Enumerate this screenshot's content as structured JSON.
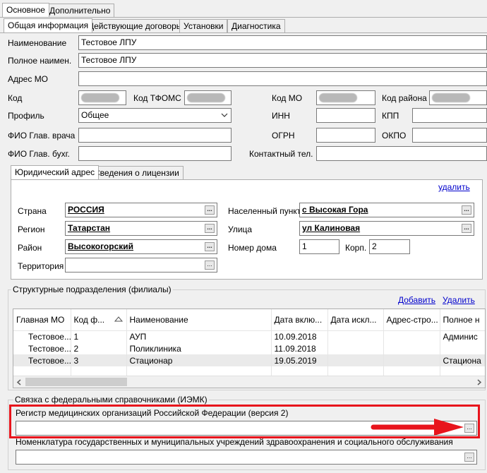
{
  "top_tabs": [
    "Основное",
    "Дополнительно"
  ],
  "sub_tabs": [
    "Общая информация",
    "Действующие договоры",
    "Установки",
    "Диагностика"
  ],
  "general": {
    "name_label": "Наименование",
    "name_value": "Тестовое ЛПУ",
    "fullname_label": "Полное наимен.",
    "fullname_value": "Тестовое ЛПУ",
    "address_label": "Адрес МО",
    "address_value": "",
    "code_label": "Код",
    "tfoms_label": "Код ТФОМС",
    "mo_code_label": "Код МО",
    "district_code_label": "Код района",
    "profile_label": "Профиль",
    "profile_value": "Общее",
    "inn_label": "ИНН",
    "kpp_label": "КПП",
    "head_label": "ФИО Глав. врача",
    "ogrn_label": "ОГРН",
    "okpo_label": "ОКПО",
    "accountant_label": "ФИО Глав. бухг.",
    "phone_label": "Контактный тел."
  },
  "address_tabs": [
    "Юридический адрес",
    "Сведения о лицензии"
  ],
  "address": {
    "delete_link": "удалить",
    "country_label": "Страна",
    "country_value": "РОССИЯ",
    "region_label": "Регион",
    "region_value": "Татарстан",
    "district_label": "Район",
    "district_value": "Высокогорский",
    "territory_label": "Территория",
    "territory_value": "",
    "settlement_label": "Населенный пункт",
    "settlement_value": "с Высокая Гора",
    "street_label": "Улица",
    "street_value": "ул Калиновая",
    "house_label": "Номер дома",
    "house_value": "1",
    "building_label": "Корп.",
    "building_value": "2",
    "dots": "..."
  },
  "branches": {
    "title": "Структурные подразделения (филиалы)",
    "add_link": "Добавить",
    "delete_link": "Удалить",
    "columns": [
      "Главная МО",
      "Код ф...",
      "Наименование",
      "Дата вклю...",
      "Дата искл...",
      "Адрес-стро...",
      "Полное н"
    ],
    "rows": [
      [
        "Тестовое...",
        "1",
        "АУП",
        "10.09.2018",
        "",
        "",
        "Админис"
      ],
      [
        "Тестовое...",
        "2",
        "Поликлиника",
        "11.09.2018",
        "",
        "",
        ""
      ],
      [
        "Тестовое...",
        "3",
        "Стационар",
        "19.05.2019",
        "",
        "",
        "Стациона"
      ]
    ]
  },
  "federal": {
    "title": "Связка с федеральными справочниками (ИЭМК)",
    "registry_label": "Регистр медицинских организаций Российской Федерации (версия 2)",
    "registry_value": "",
    "nomenclature_label": "Номенклатура государственных и муниципальных учреждений здравоохранения и социального обслуживания",
    "nomenclature_value": ""
  },
  "colors": {
    "highlight": "#e8141c",
    "link": "#0000cc",
    "selected_row": "#dde9f6"
  }
}
